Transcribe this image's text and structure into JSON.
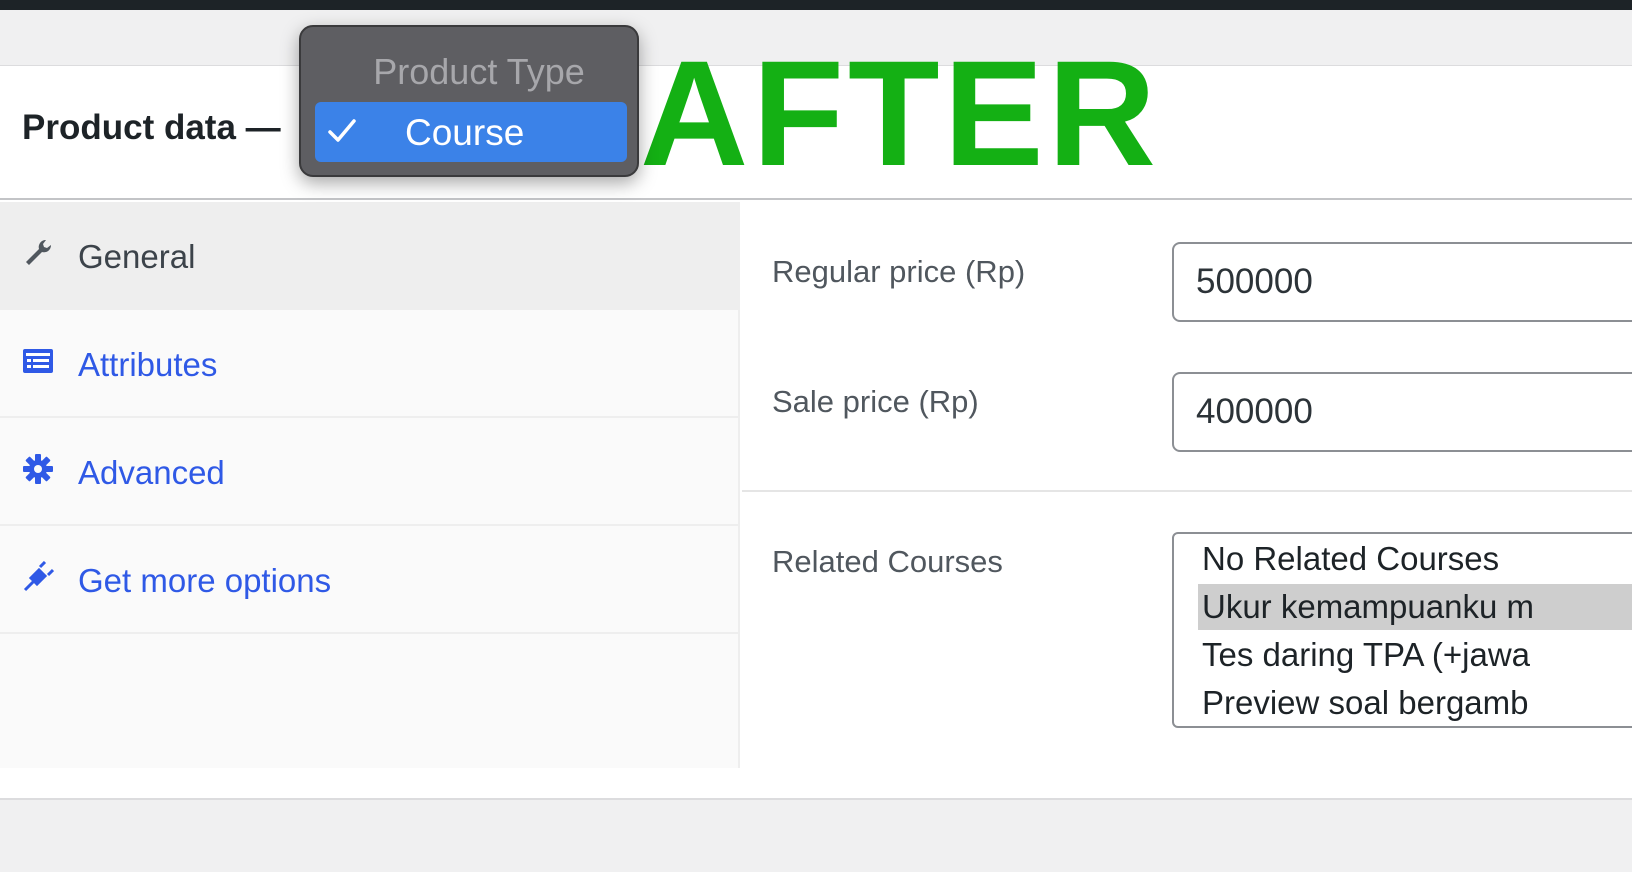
{
  "panel": {
    "title": "Product data —"
  },
  "overlay_text": "AFTER",
  "product_type_dropdown": {
    "header": "Product Type",
    "selected_option": "Course"
  },
  "tabs": [
    {
      "label": "General",
      "icon": "wrench-icon",
      "active": true
    },
    {
      "label": "Attributes",
      "icon": "list-icon",
      "active": false
    },
    {
      "label": "Advanced",
      "icon": "gear-icon",
      "active": false
    },
    {
      "label": "Get more options",
      "icon": "plugin-icon",
      "active": false
    }
  ],
  "fields": {
    "regular_price": {
      "label": "Regular price (Rp)",
      "value": "500000"
    },
    "sale_price": {
      "label": "Sale price (Rp)",
      "value": "400000"
    },
    "related_courses": {
      "label": "Related Courses",
      "options": [
        "No Related Courses",
        "Ukur kemampuanku m",
        "Tes daring TPA (+jawa",
        "Preview soal bergamb"
      ],
      "selected_index": 1
    }
  },
  "colors": {
    "link_blue": "#2f59e6",
    "after_green": "#14b014",
    "dropdown_highlight": "#3b82e8"
  }
}
